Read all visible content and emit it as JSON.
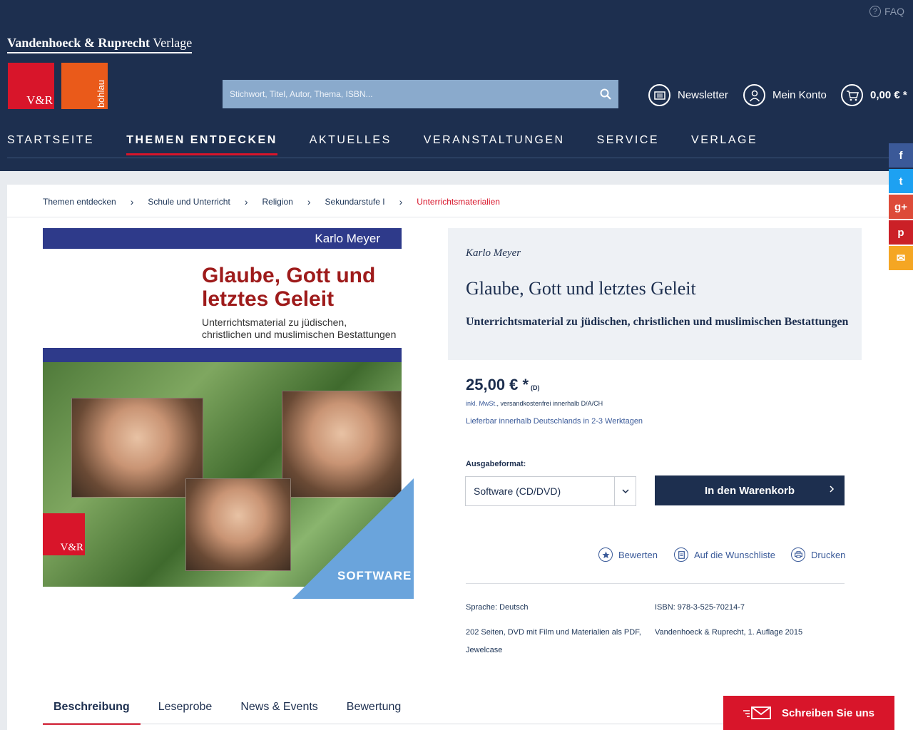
{
  "header": {
    "faq": "FAQ",
    "brand_bold": "Vandenhoeck & Ruprecht",
    "brand_light": "Verlage",
    "logo_vr": "V&R",
    "logo_bohlau": "böhlau",
    "search_placeholder": "Stichwort, Titel, Autor, Thema, ISBN...",
    "newsletter": "Newsletter",
    "account": "Mein Konto",
    "cart_total": "0,00 € *"
  },
  "nav": {
    "items": [
      "STARTSEITE",
      "THEMEN ENTDECKEN",
      "AKTUELLES",
      "VERANSTALTUNGEN",
      "SERVICE",
      "VERLAGE"
    ],
    "active": "THEMEN ENTDECKEN"
  },
  "social": {
    "facebook": "f",
    "twitter": "t",
    "gplus": "g+",
    "pinterest": "p",
    "mail": "✉",
    "colors": {
      "facebook": "#3b5998",
      "twitter": "#1da1f2",
      "gplus": "#dd4b39",
      "pinterest": "#cb2027",
      "mail": "#f5a623"
    }
  },
  "breadcrumb": [
    "Themen entdecken",
    "Schule und Unterricht",
    "Religion",
    "Sekundarstufe I",
    "Unterrichtsmaterialien"
  ],
  "cover": {
    "author": "Karlo Meyer",
    "title_line1": "Glaube, Gott und",
    "title_line2": "letztes Geleit",
    "sub_line1": "Unterrichtsmaterial zu jüdischen,",
    "sub_line2": "christlichen und muslimischen Bestattungen",
    "logo": "V&R",
    "badge": "SOFTWARE"
  },
  "product": {
    "author": "Karlo Meyer",
    "title": "Glaube, Gott und letztes Geleit",
    "subtitle": "Unterrichtsmaterial zu jüdischen, christlichen und muslimischen Bestattungen",
    "price": "25,00 € *",
    "price_region": "(D)",
    "tax_link": "inkl. MwSt.",
    "tax_rest": ", versandkostenfrei innerhalb D/A/CH",
    "delivery": "Lieferbar innerhalb Deutschlands in 2-3 Werktagen",
    "format_label": "Ausgabeformat:",
    "format_value": "Software (CD/DVD)",
    "cart_button": "In den Warenkorb",
    "actions": {
      "rate": "Bewerten",
      "wishlist": "Auf die Wunschliste",
      "print": "Drucken"
    },
    "meta": {
      "language": "Sprache: Deutsch",
      "isbn": "ISBN: 978-3-525-70214-7",
      "pages_line1": "202 Seiten, DVD mit Film und Materialien als PDF,",
      "pages_line2": "Jewelcase",
      "publisher": "Vandenhoeck & Ruprecht, 1. Auflage 2015"
    }
  },
  "tabs": [
    "Beschreibung",
    "Leseprobe",
    "News & Events",
    "Bewertung"
  ],
  "contact_button": "Schreiben Sie uns"
}
